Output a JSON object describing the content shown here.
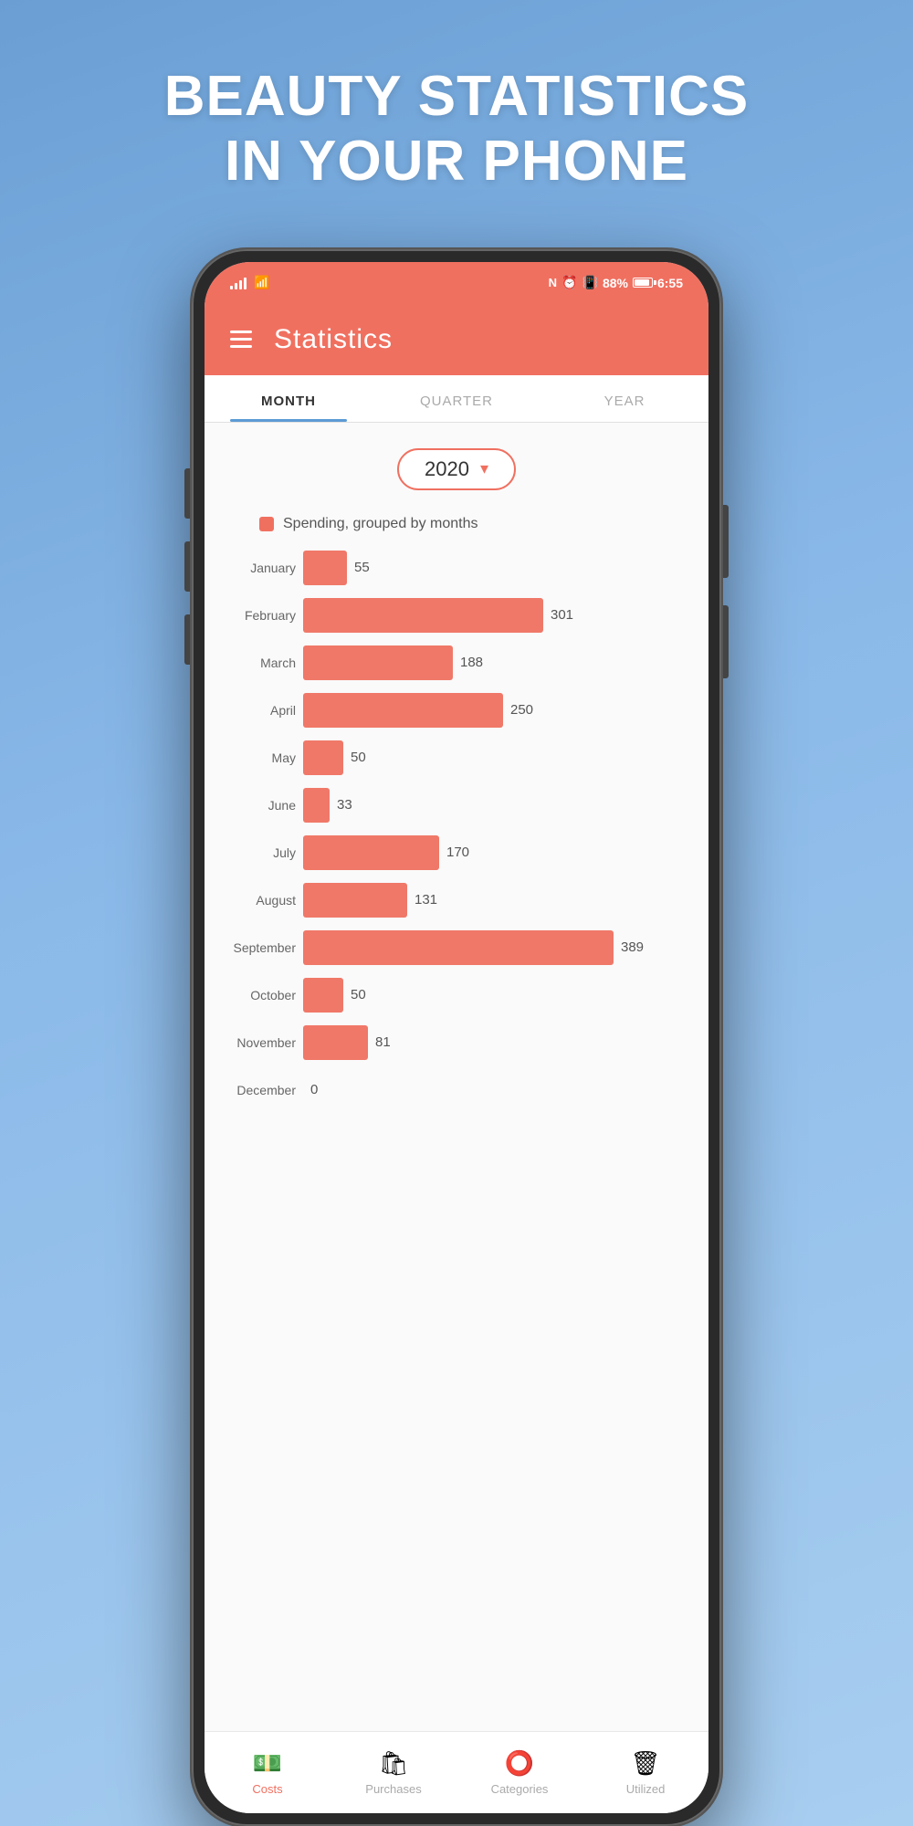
{
  "hero": {
    "title_line1": "BEAUTY STATISTICS",
    "title_line2": "IN YOUR PHONE"
  },
  "status_bar": {
    "battery_percent": "88%",
    "time": "6:55"
  },
  "app_header": {
    "title": "Statistics"
  },
  "tabs": [
    {
      "id": "month",
      "label": "MONTH",
      "active": true
    },
    {
      "id": "quarter",
      "label": "QUARTER",
      "active": false
    },
    {
      "id": "year",
      "label": "YEAR",
      "active": false
    }
  ],
  "year_selector": {
    "value": "2020"
  },
  "chart": {
    "legend_label": "Spending, grouped by months",
    "max_value": 389,
    "bars": [
      {
        "month": "January",
        "value": 55
      },
      {
        "month": "February",
        "value": 301
      },
      {
        "month": "March",
        "value": 188
      },
      {
        "month": "April",
        "value": 250
      },
      {
        "month": "May",
        "value": 50
      },
      {
        "month": "June",
        "value": 33
      },
      {
        "month": "July",
        "value": 170
      },
      {
        "month": "August",
        "value": 131
      },
      {
        "month": "September",
        "value": 389
      },
      {
        "month": "October",
        "value": 50
      },
      {
        "month": "November",
        "value": 81
      },
      {
        "month": "December",
        "value": 0
      }
    ]
  },
  "bottom_nav": [
    {
      "id": "costs",
      "label": "Costs",
      "icon": "💵",
      "active": true
    },
    {
      "id": "purchases",
      "label": "Purchases",
      "icon": "🛍",
      "active": false
    },
    {
      "id": "categories",
      "label": "Categories",
      "icon": "⭕",
      "active": false
    },
    {
      "id": "utilized",
      "label": "Utilized",
      "icon": "🗑",
      "active": false
    }
  ]
}
